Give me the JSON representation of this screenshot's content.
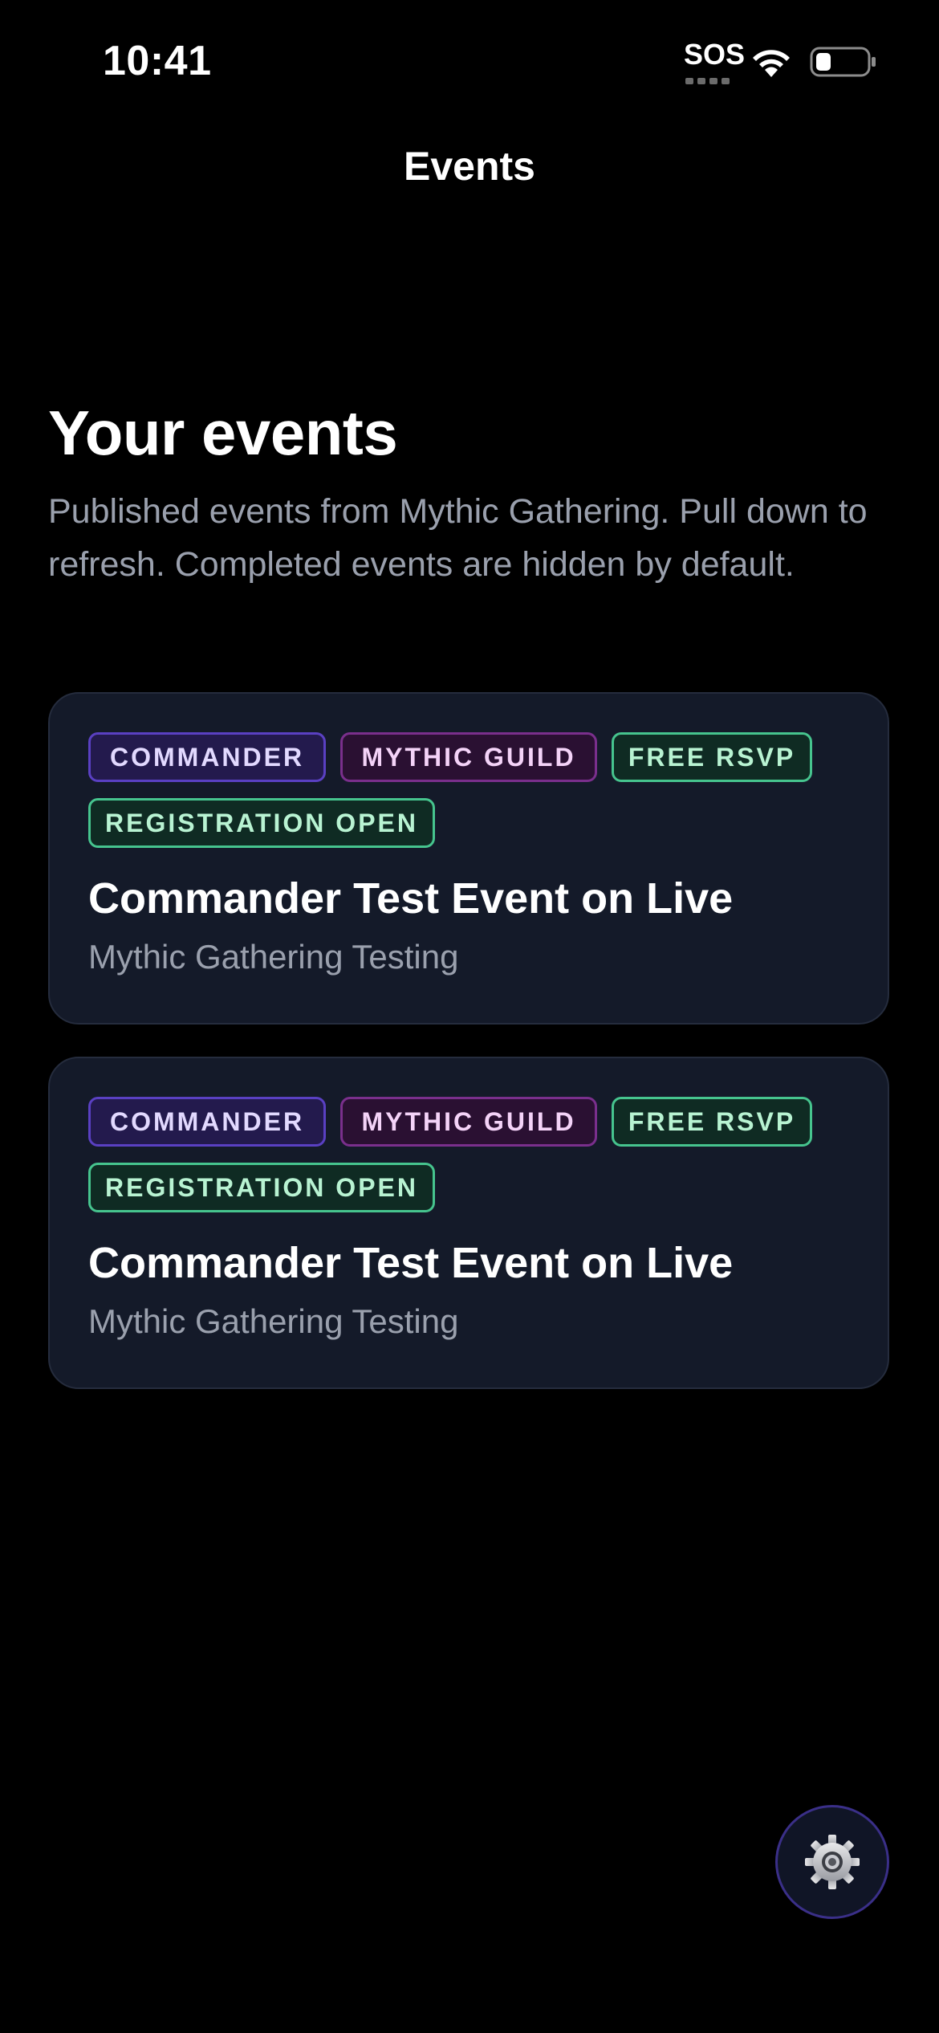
{
  "status_bar": {
    "time": "10:41",
    "carrier": "SOS",
    "wifi_icon": "wifi-icon",
    "battery_icon": "battery-icon"
  },
  "nav": {
    "title": "Events"
  },
  "header": {
    "heading": "Your events",
    "description": "Published events from Mythic Gathering. Pull down to refresh. Completed events are hidden by default."
  },
  "events": [
    {
      "tags": [
        "COMMANDER",
        "MYTHIC GUILD",
        "FREE RSVP",
        "REGISTRATION OPEN"
      ],
      "title": "Commander Test Event on Live",
      "organizer": "Mythic Gathering Testing"
    },
    {
      "tags": [
        "COMMANDER",
        "MYTHIC GUILD",
        "FREE RSVP",
        "REGISTRATION OPEN"
      ],
      "title": "Commander Test Event on Live",
      "organizer": "Mythic Gathering Testing"
    }
  ],
  "settings": {
    "icon": "gear-icon"
  },
  "colors": {
    "background": "#000000",
    "card": "#141a29",
    "tag_commander": "#5a40c2",
    "tag_guild": "#7a2f8c",
    "tag_green": "#46c48e"
  }
}
